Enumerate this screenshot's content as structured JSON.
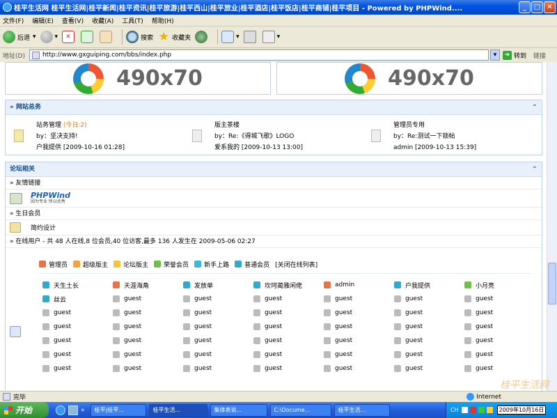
{
  "window": {
    "title": "桂平生活网 桂平生活网|桂平新闻|桂平资讯|桂平旅游|桂平西山|桂平旅业|桂平酒店|桂平饭店|桂平商铺|桂平项目 - Powered by PHPWind...."
  },
  "menu": [
    "文件(F)",
    "编辑(E)",
    "查看(V)",
    "收藏(A)",
    "工具(T)",
    "帮助(H)"
  ],
  "toolbar": {
    "back": "后退",
    "search": "搜索",
    "favorites": "收藏夹"
  },
  "address": {
    "label": "地址(D)",
    "url": "http://www.gxguiping.com/bbs/index.php",
    "go": "转到",
    "links": "链接"
  },
  "ads": {
    "left": "490x70",
    "right": "490x70"
  },
  "announcements": {
    "title": "» 网站总务",
    "items": [
      {
        "title": "站务管理",
        "today": "(今日:2)",
        "by": "by：坚决支持!",
        "meta": "户我提供 [2009-10-16 01:28]"
      },
      {
        "title": "版主茶楼",
        "today": "",
        "by": "by：Re:《得城飞歌》LOGO",
        "meta": "爱系我的 [2009-10-13 13:00]"
      },
      {
        "title": "管理员专用",
        "today": "",
        "by": "by：Re:测试一下锁帖",
        "meta": "admin [2009-10-13 15:39]"
      }
    ]
  },
  "forum": {
    "title": "论坛相关",
    "links_label": "» 友情链接",
    "phpwind_logo": "PHPWind",
    "phpwind_slogan": "因为专业 所以优秀",
    "birthday_label": "» 生日会员",
    "birthday_member": "简约设计",
    "online_label": "» 在线用户  - 共 48 人在线,8 位会员,40 位访客,最多 136 人发生在 2009-05-06 02:27"
  },
  "legend": [
    {
      "label": "管理员",
      "color": "#e8734a"
    },
    {
      "label": "超级版主",
      "color": "#f2a440"
    },
    {
      "label": "论坛版主",
      "color": "#f4c542"
    },
    {
      "label": "荣誉会员",
      "color": "#6fbf4a"
    },
    {
      "label": "新手上路",
      "color": "#3cb8d8"
    },
    {
      "label": "普通会员",
      "color": "#33aacc"
    },
    {
      "label": "[关闭在线列表]",
      "color": ""
    }
  ],
  "online_users": [
    [
      {
        "n": "天生土长",
        "c": "#33aacc"
      },
      {
        "n": "天涯海角",
        "c": "#e8734a"
      },
      {
        "n": "发放单",
        "c": "#33aacc"
      },
      {
        "n": "坎坷蔺雅闲佬",
        "c": "#33aacc"
      },
      {
        "n": "admin",
        "c": "#e8734a"
      },
      {
        "n": "户我提供",
        "c": "#33aacc"
      },
      {
        "n": "小月亮",
        "c": "#6fbf4a"
      }
    ],
    [
      {
        "n": "丝云",
        "c": "#33aacc"
      },
      {
        "n": "guest",
        "c": "#bbb"
      },
      {
        "n": "guest",
        "c": "#bbb"
      },
      {
        "n": "guest",
        "c": "#bbb"
      },
      {
        "n": "guest",
        "c": "#bbb"
      },
      {
        "n": "guest",
        "c": "#bbb"
      },
      {
        "n": "guest",
        "c": "#bbb"
      }
    ],
    [
      {
        "n": "guest",
        "c": "#bbb"
      },
      {
        "n": "guest",
        "c": "#bbb"
      },
      {
        "n": "guest",
        "c": "#bbb"
      },
      {
        "n": "guest",
        "c": "#bbb"
      },
      {
        "n": "guest",
        "c": "#bbb"
      },
      {
        "n": "guest",
        "c": "#bbb"
      },
      {
        "n": "guest",
        "c": "#bbb"
      }
    ],
    [
      {
        "n": "guest",
        "c": "#bbb"
      },
      {
        "n": "guest",
        "c": "#bbb"
      },
      {
        "n": "guest",
        "c": "#bbb"
      },
      {
        "n": "guest",
        "c": "#bbb"
      },
      {
        "n": "guest",
        "c": "#bbb"
      },
      {
        "n": "guest",
        "c": "#bbb"
      },
      {
        "n": "guest",
        "c": "#bbb"
      }
    ],
    [
      {
        "n": "guest",
        "c": "#bbb"
      },
      {
        "n": "guest",
        "c": "#bbb"
      },
      {
        "n": "guest",
        "c": "#bbb"
      },
      {
        "n": "guest",
        "c": "#bbb"
      },
      {
        "n": "guest",
        "c": "#bbb"
      },
      {
        "n": "guest",
        "c": "#bbb"
      },
      {
        "n": "guest",
        "c": "#bbb"
      }
    ],
    [
      {
        "n": "guest",
        "c": "#bbb"
      },
      {
        "n": "guest",
        "c": "#bbb"
      },
      {
        "n": "guest",
        "c": "#bbb"
      },
      {
        "n": "guest",
        "c": "#bbb"
      },
      {
        "n": "guest",
        "c": "#bbb"
      },
      {
        "n": "guest",
        "c": "#bbb"
      },
      {
        "n": "guest",
        "c": "#bbb"
      }
    ],
    [
      {
        "n": "guest",
        "c": "#bbb"
      },
      {
        "n": "guest",
        "c": "#bbb"
      },
      {
        "n": "guest",
        "c": "#bbb"
      },
      {
        "n": "guest",
        "c": "#bbb"
      },
      {
        "n": "guest",
        "c": "#bbb"
      },
      {
        "n": "guest",
        "c": "#bbb"
      },
      {
        "n": "guest",
        "c": "#bbb"
      }
    ]
  ],
  "status": {
    "text": "完毕",
    "zone": "Internet",
    "watermark": "桂平生活网"
  },
  "taskbar": {
    "start": "开始",
    "tasks": [
      "桂平|桂平...",
      "桂平生活...",
      "集体表说...",
      "C:\\Docume...",
      "桂平生活..."
    ],
    "clock": "2009年10月16日"
  }
}
